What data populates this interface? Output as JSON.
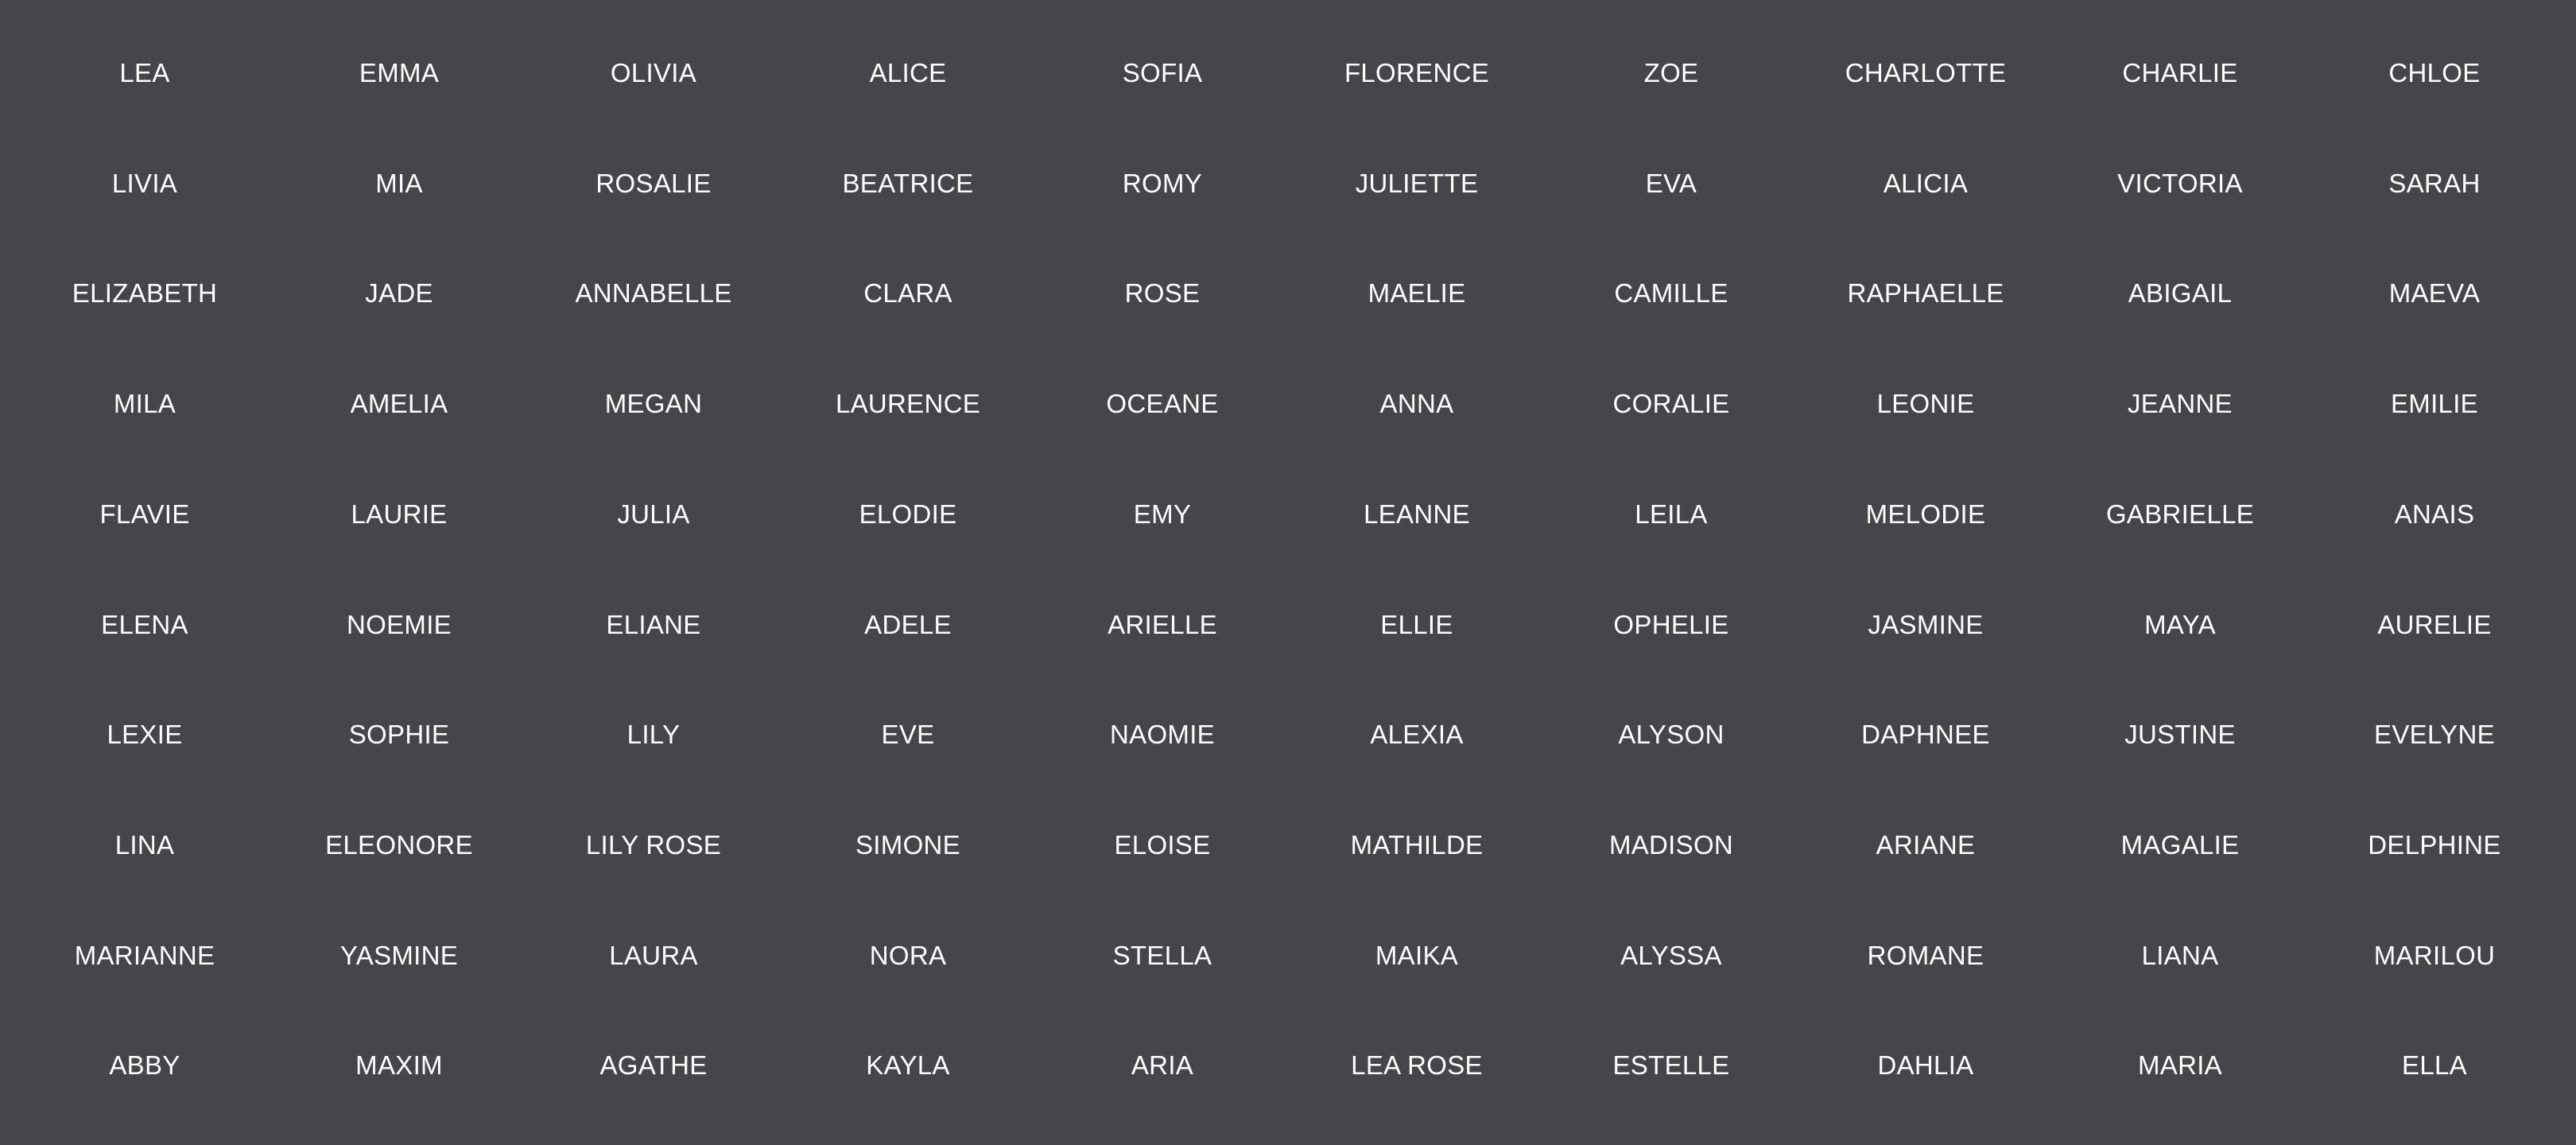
{
  "name_rows": [
    [
      "LEA",
      "EMMA",
      "OLIVIA",
      "ALICE",
      "SOFIA",
      "FLORENCE",
      "ZOE",
      "CHARLOTTE",
      "CHARLIE",
      "CHLOE"
    ],
    [
      "LIVIA",
      "MIA",
      "ROSALIE",
      "BEATRICE",
      "ROMY",
      "JULIETTE",
      "EVA",
      "ALICIA",
      "VICTORIA",
      "SARAH"
    ],
    [
      "ELIZABETH",
      "JADE",
      "ANNABELLE",
      "CLARA",
      "ROSE",
      "MAELIE",
      "CAMILLE",
      "RAPHAELLE",
      "ABIGAIL",
      "MAEVA"
    ],
    [
      "MILA",
      "AMELIA",
      "MEGAN",
      "LAURENCE",
      "OCEANE",
      "ANNA",
      "CORALIE",
      "LEONIE",
      "JEANNE",
      "EMILIE"
    ],
    [
      "FLAVIE",
      "LAURIE",
      "JULIA",
      "ELODIE",
      "EMY",
      "LEANNE",
      "LEILA",
      "MELODIE",
      "GABRIELLE",
      "ANAIS"
    ],
    [
      "ELENA",
      "NOEMIE",
      "ELIANE",
      "ADELE",
      "ARIELLE",
      "ELLIE",
      "OPHELIE",
      "JASMINE",
      "MAYA",
      "AURELIE"
    ],
    [
      "LEXIE",
      "SOPHIE",
      "LILY",
      "EVE",
      "NAOMIE",
      "ALEXIA",
      "ALYSON",
      "DAPHNEE",
      "JUSTINE",
      "EVELYNE"
    ],
    [
      "LINA",
      "ELEONORE",
      "LILY ROSE",
      "SIMONE",
      "ELOISE",
      "MATHILDE",
      "MADISON",
      "ARIANE",
      "MAGALIE",
      "DELPHINE"
    ],
    [
      "MARIANNE",
      "YASMINE",
      "LAURA",
      "NORA",
      "STELLA",
      "MAIKA",
      "ALYSSA",
      "ROMANE",
      "LIANA",
      "MARILOU"
    ],
    [
      "ABBY",
      "MAXIM",
      "AGATHE",
      "KAYLA",
      "ARIA",
      "LEA ROSE",
      "ESTELLE",
      "DAHLIA",
      "MARIA",
      "ELLA"
    ]
  ]
}
